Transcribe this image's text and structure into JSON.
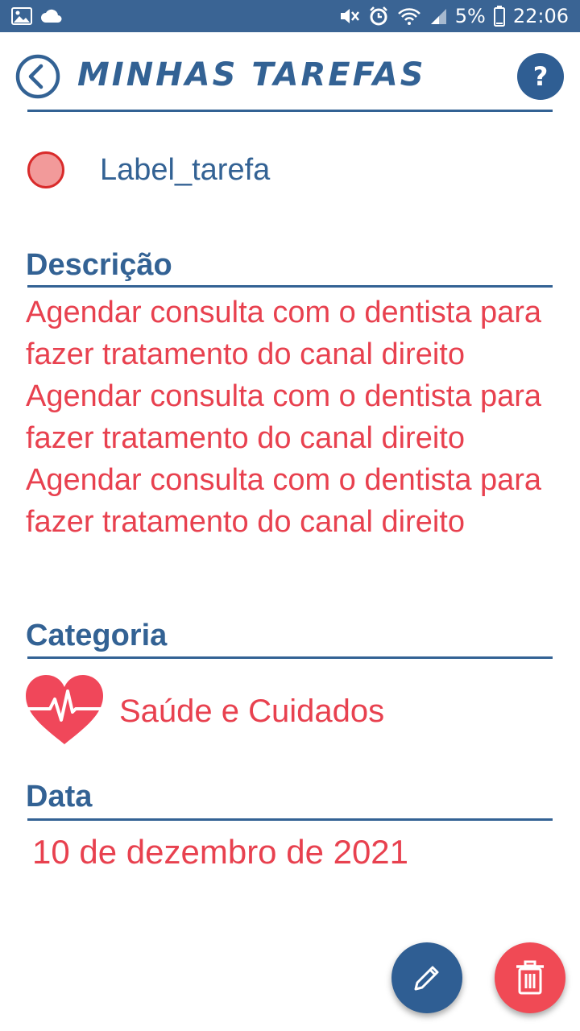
{
  "status_bar": {
    "battery": "5%",
    "time": "22:06",
    "icons": [
      "image-icon",
      "cloud-icon",
      "mute-icon",
      "alarm-icon",
      "wifi-icon",
      "signal-icon",
      "battery-icon"
    ]
  },
  "header": {
    "title": "MINHAS TAREFAS",
    "help_label": "?"
  },
  "task": {
    "label": "Label_tarefa",
    "status_color": "#f29a9a"
  },
  "description": {
    "heading": "Descrição",
    "text": "Agendar consulta com o dentista para fazer tratamento do canal direito Agendar consulta com o dentista para fazer tratamento do canal direito Agendar consulta com o dentista para fazer tratamento do canal direito"
  },
  "category": {
    "heading": "Categoria",
    "label": "Saúde e Cuidados",
    "icon": "heart-pulse-icon"
  },
  "date": {
    "heading": "Data",
    "value": "10 de dezembro de 2021"
  },
  "actions": {
    "edit_icon": "pencil-icon",
    "delete_icon": "trash-icon"
  },
  "colors": {
    "primary": "#336294",
    "accent": "#e8414f",
    "status_bar": "#3a6494"
  }
}
